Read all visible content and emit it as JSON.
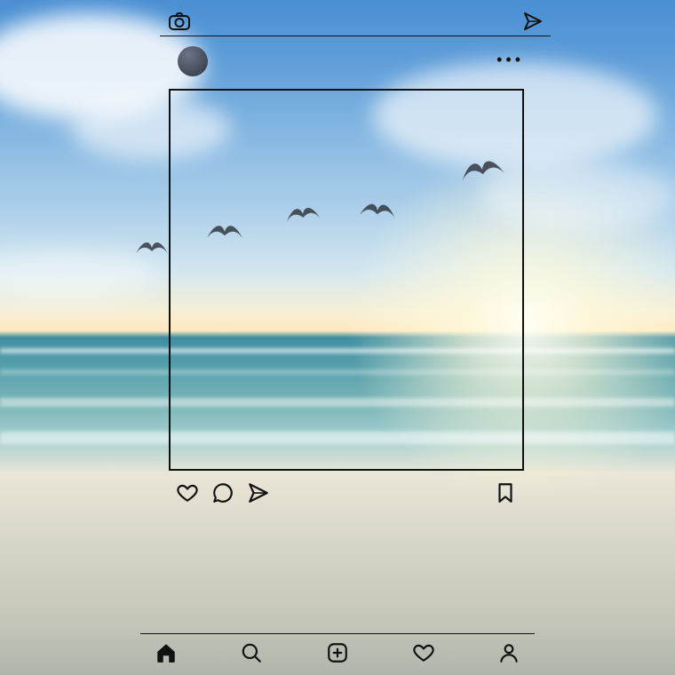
{
  "scene": {
    "description": "Beach at golden hour with calm surf, wispy clouds, sun glow near horizon, and a small flock of birds",
    "birds_count": 5
  },
  "overlay": {
    "style": "instagram-wireframe",
    "stroke_color": "#111111",
    "top_bar": {
      "left_icon": "camera",
      "right_icon": "direct-message"
    },
    "profile_row": {
      "avatar": "dark-circle",
      "more_glyph": "•••"
    },
    "post_frame": "square-outline",
    "action_row": {
      "icons": [
        "heart",
        "comment",
        "share",
        "bookmark"
      ]
    },
    "bottom_nav": {
      "icons": [
        "home",
        "search",
        "add",
        "activity",
        "profile"
      ],
      "active": "home"
    }
  }
}
